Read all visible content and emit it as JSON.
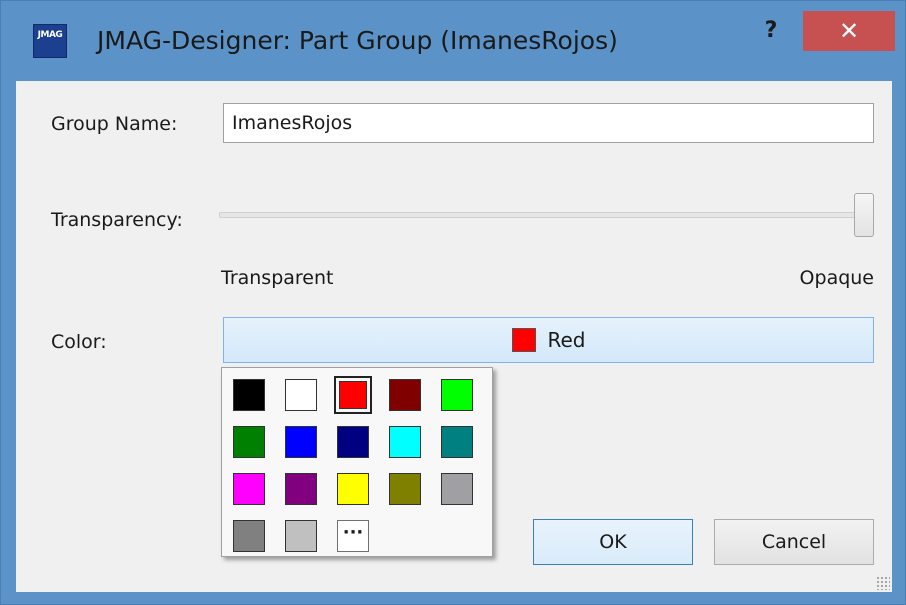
{
  "window": {
    "title": "JMAG-Designer: Part Group (ImanesRojos)",
    "app_icon_text": "JMAG",
    "help_glyph": "?",
    "close_glyph": "✕"
  },
  "group_name": {
    "label": "Group Name:",
    "value": "ImanesRojos"
  },
  "transparency": {
    "label": "Transparency:",
    "min_label": "Transparent",
    "max_label": "Opaque",
    "value": 1.0
  },
  "color": {
    "label": "Color:",
    "selected_name": "Red",
    "selected_hex": "#ff0000"
  },
  "palette": {
    "swatches": [
      {
        "hex": "#000000",
        "selected": false
      },
      {
        "hex": "#ffffff",
        "selected": false
      },
      {
        "hex": "#ff0000",
        "selected": true
      },
      {
        "hex": "#800000",
        "selected": false
      },
      {
        "hex": "#00ff00",
        "selected": false
      },
      {
        "hex": "#008000",
        "selected": false
      },
      {
        "hex": "#0000ff",
        "selected": false
      },
      {
        "hex": "#000080",
        "selected": false
      },
      {
        "hex": "#00ffff",
        "selected": false
      },
      {
        "hex": "#008080",
        "selected": false
      },
      {
        "hex": "#ff00ff",
        "selected": false
      },
      {
        "hex": "#800080",
        "selected": false
      },
      {
        "hex": "#ffff00",
        "selected": false
      },
      {
        "hex": "#808000",
        "selected": false
      },
      {
        "hex": "#a0a0a4",
        "selected": false
      },
      {
        "hex": "#808080",
        "selected": false
      },
      {
        "hex": "#c0c0c0",
        "selected": false
      }
    ],
    "more_label": "···"
  },
  "buttons": {
    "ok": "OK",
    "cancel": "Cancel"
  }
}
